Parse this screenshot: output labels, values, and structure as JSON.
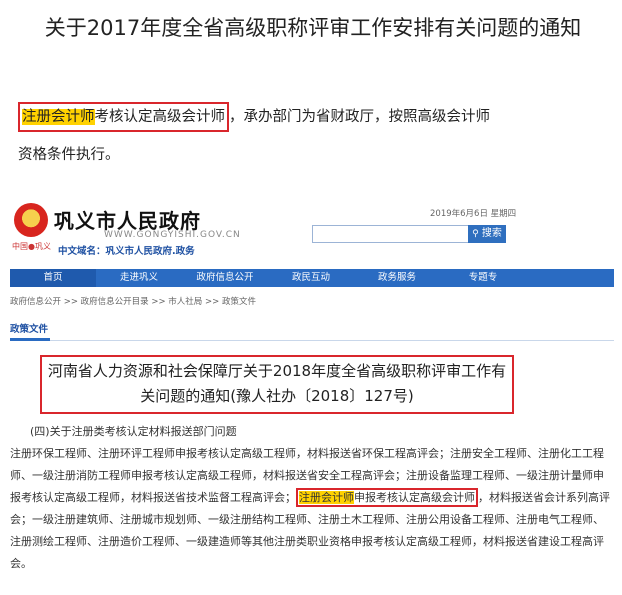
{
  "doc": {
    "title": "关于2017年度全省高级职称评审工作安排有关问题的通知",
    "para": {
      "highlight": "注册会计师",
      "exam": "考核认定高级会计师",
      "rest1": "，承办部门为省财政厅，按照高级会计师",
      "rest2": "资格条件执行。"
    }
  },
  "gov": {
    "site_name": "巩义市人民政府",
    "url": "WWW.GONGYISHI.GOV.CN",
    "domain": "中文域名：巩义市人民政府.政务",
    "emblem_label": "中国●巩义",
    "date": "2019年6月6日 星期四",
    "search_btn": "搜索",
    "nav": [
      "首页",
      "走进巩义",
      "政府信息公开",
      "政民互动",
      "政务服务",
      "专题专"
    ],
    "breadcrumb": "政府信息公开 >> 政府信息公开目录 >> 市人社局 >> 政策文件",
    "section": "政策文件",
    "notice_title": "河南省人力资源和社会保障厅关于2018年度全省高级职称评审工作有关问题的通知(豫人社办〔2018〕127号)",
    "sub": "(四)关于注册类考核认定材料报送部门问题",
    "body": {
      "part1": "注册环保工程师、注册环评工程师申报考核认定高级工程师，材料报送省环保工程高评会；注册安全工程师、注册化工工程师、一级注册消防工程师申报考核认定高级工程师，材料报送省安全工程高评会；注册设备监理工程师、一级注册计量师申报考核认定高级工程师，材料报送省技术监督工程高评会；",
      "highlight": "注册会计师",
      "part2": "申报考核认定高级会计师",
      "part3": "，材料报送省会计系列高评会；一级注册建筑师、注册城市规划师、一级注册结构工程师、注册土木工程师、注册公用设备工程师、注册电气工程师、注册测绘工程师、注册造价工程师、一级建造师等其他注册类职业资格申报考核认定高级工程师，材料报送省建设工程高评会。"
    }
  }
}
